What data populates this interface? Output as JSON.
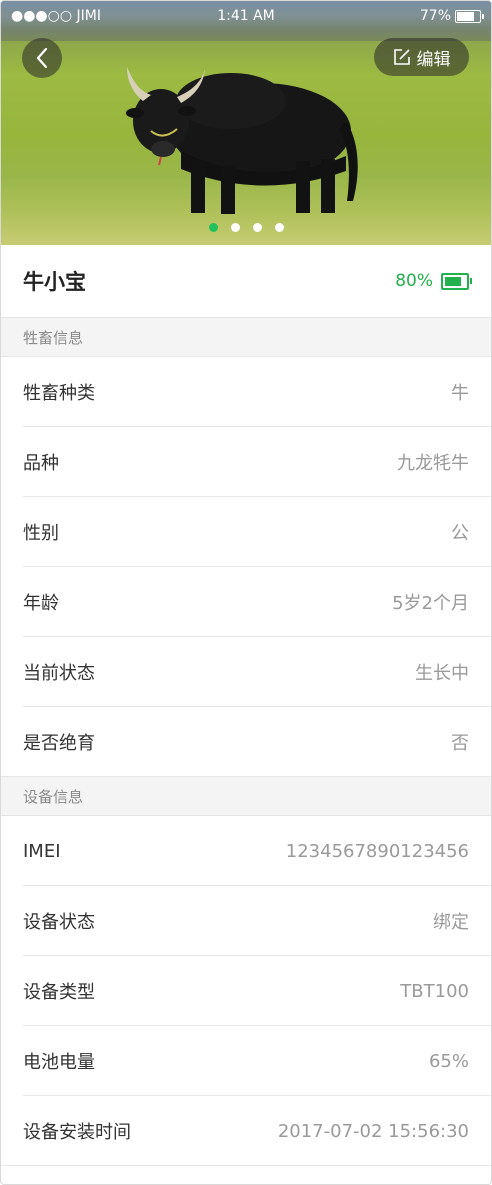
{
  "status_bar": {
    "carrier": "●●●○○ JIMI",
    "time": "1:41 AM",
    "battery": "77%"
  },
  "header": {
    "back_icon": "chevron-left-icon",
    "edit_label": "编辑",
    "edit_icon": "edit-icon"
  },
  "carousel": {
    "total": 4,
    "active_index": 0
  },
  "animal": {
    "name": "牛小宝",
    "battery": "80%"
  },
  "livestock_section": {
    "title": "牲畜信息",
    "rows": [
      {
        "label": "牲畜种类",
        "value": "牛"
      },
      {
        "label": "品种",
        "value": "九龙牦牛"
      },
      {
        "label": "性别",
        "value": "公"
      },
      {
        "label": "年龄",
        "value": "5岁2个月"
      },
      {
        "label": "当前状态",
        "value": "生长中"
      },
      {
        "label": "是否绝育",
        "value": "否"
      }
    ]
  },
  "device_section": {
    "title": "设备信息",
    "rows": [
      {
        "label": "IMEI",
        "value": "1234567890123456"
      },
      {
        "label": "设备状态",
        "value": "绑定"
      },
      {
        "label": "设备类型",
        "value": "TBT100"
      },
      {
        "label": "电池电量",
        "value": "65%"
      },
      {
        "label": "设备安装时间",
        "value": "2017-07-02 15:56:30"
      }
    ]
  },
  "colors": {
    "accent": "#22c15e",
    "battery_green": "#22b14c",
    "section_bg": "#f4f4f4"
  }
}
